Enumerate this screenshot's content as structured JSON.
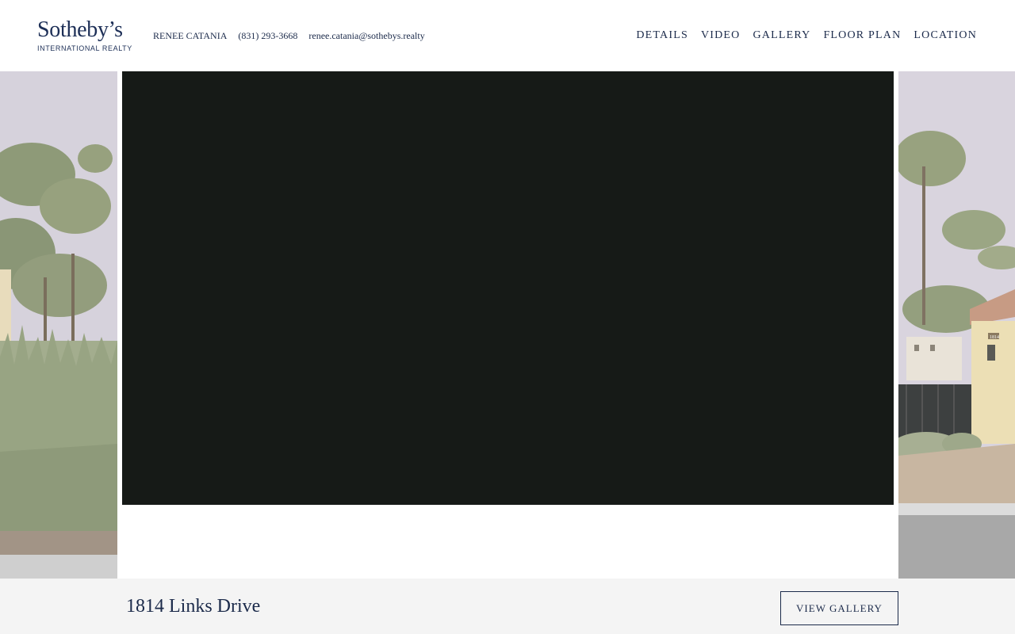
{
  "brand": {
    "logo_main": "Sotheby’s",
    "logo_sub": "INTERNATIONAL REALTY"
  },
  "agent": {
    "name": "RENEE CATANIA",
    "phone": "(831) 293-3668",
    "email": "renee.catania@sothebys.realty"
  },
  "nav": {
    "items": [
      {
        "label": "DETAILS"
      },
      {
        "label": "VIDEO"
      },
      {
        "label": "GALLERY"
      },
      {
        "label": "FLOOR PLAN"
      },
      {
        "label": "LOCATION"
      }
    ]
  },
  "listing": {
    "address": "1814 Links Drive",
    "gallery_button": "VIEW GALLERY"
  },
  "house_number_plate": "1814",
  "colors": {
    "brand_navy": "#1b2a4a",
    "video_bg": "#161a17",
    "footer_bg": "#f4f4f4"
  }
}
